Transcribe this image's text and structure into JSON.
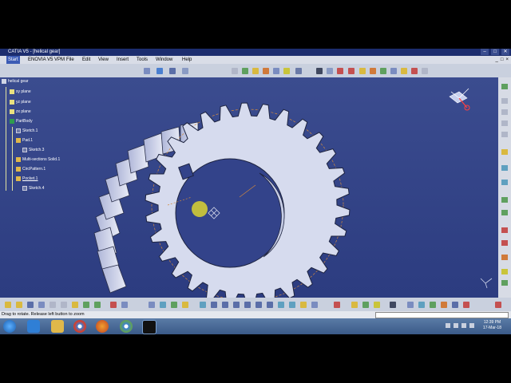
{
  "window": {
    "title": "CATIA V5 - [helical gear]",
    "controls": [
      "–",
      "□",
      "✕"
    ]
  },
  "menu": {
    "items": [
      "Start",
      "ENOVIA V5 VPM",
      "File",
      "Edit",
      "View",
      "Insert",
      "Tools",
      "Window",
      "Help"
    ],
    "doc_controls": [
      "_",
      "□",
      "×"
    ]
  },
  "tree": {
    "root": "helical gear",
    "xy": "xy plane",
    "yz": "yz plane",
    "zx": "zx plane",
    "partbody": "PartBody",
    "sketch1": "Sketch.1",
    "pad1": "Pad.1",
    "sketch3": "Sketch.3",
    "multi": "Multi-sections Solid.1",
    "circ": "CircPattern.1",
    "pocket": "Pocket.1",
    "sketch4": "Sketch.4"
  },
  "status": {
    "message": "Drag to rotate. Release left button to zoom"
  },
  "clock": {
    "time": "12:39 PM",
    "date": "17-Mar-18"
  },
  "colors": {
    "viewport": "#33438a",
    "gear_face": "#d6dbee",
    "gear_shadow": "#8a93c4",
    "highlight": "#c9c43a",
    "construction": "#d48a3c"
  },
  "icons": {
    "taskbar": [
      "windows-start-icon",
      "ie-icon",
      "explorer-icon",
      "chrome-icon",
      "firefox-icon",
      "chrome-alt-icon",
      "catia-icon"
    ],
    "compass": "compass-icon"
  }
}
